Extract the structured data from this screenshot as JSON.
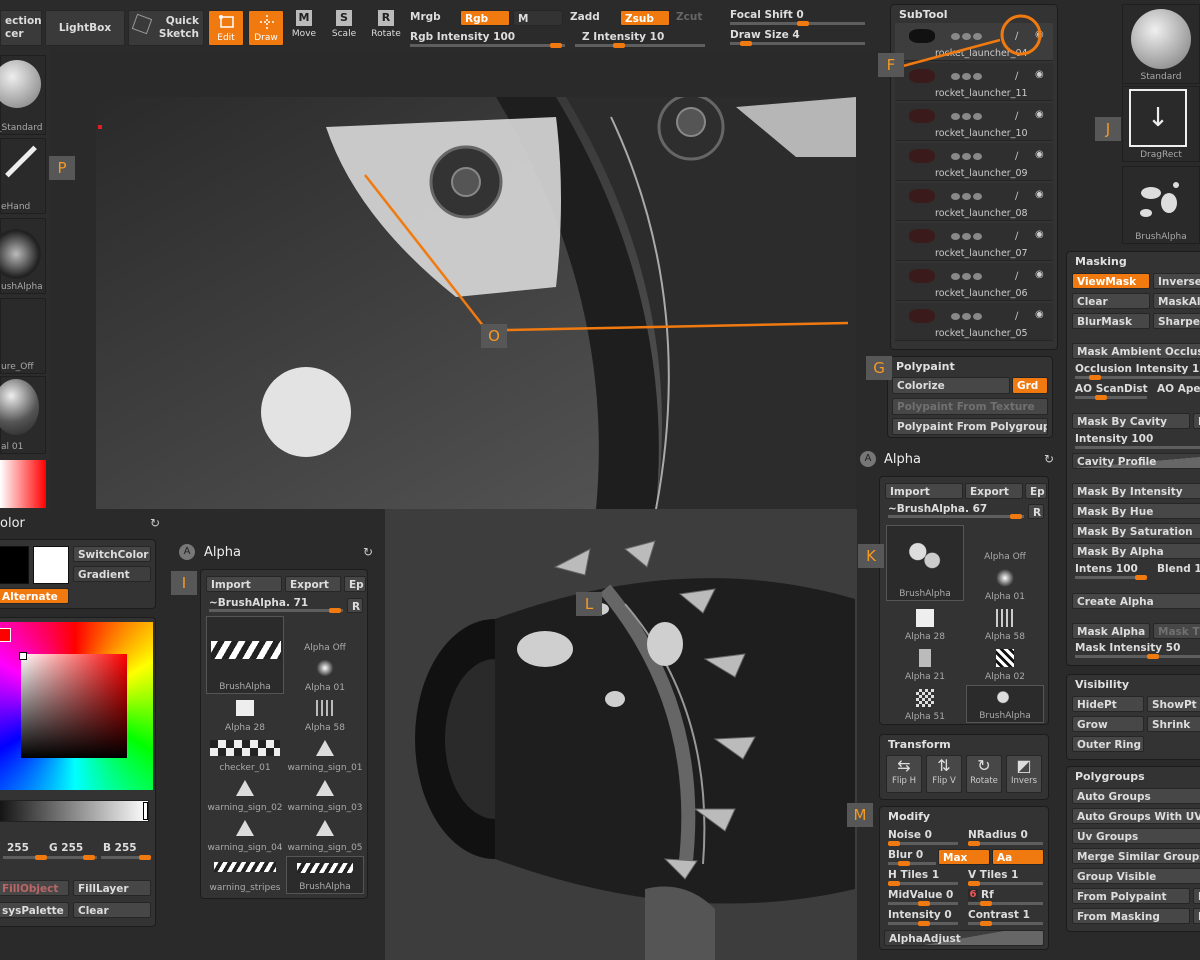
{
  "toolbar": {
    "selection": "ection",
    "selection2": "cer",
    "lightbox": "LightBox",
    "quick": "Quick",
    "sketch": "Sketch",
    "edit": "Edit",
    "draw": "Draw",
    "move": "Move",
    "scale": "Scale",
    "rotate": "Rotate",
    "mrgb": "Mrgb",
    "rgb": "Rgb",
    "m": "M",
    "zadd": "Zadd",
    "zsub": "Zsub",
    "zcut": "Zcut",
    "rgb_intensity": "Rgb Intensity 100",
    "z_intensity": "Z Intensity 10",
    "focal_shift": "Focal Shift 0",
    "draw_size": "Draw Size 4"
  },
  "left_tray": {
    "items": [
      "_Standard",
      "eHand",
      "ushAlpha",
      "ure_Off",
      "al 01"
    ]
  },
  "subtool": {
    "title": "SubTool",
    "items": [
      "rocket_launcher_04",
      "rocket_launcher_11",
      "rocket_launcher_10",
      "rocket_launcher_09",
      "rocket_launcher_08",
      "rocket_launcher_07",
      "rocket_launcher_06",
      "rocket_launcher_05"
    ]
  },
  "polypaint": {
    "title": "Polypaint",
    "colorize": "Colorize",
    "grd": "Grd",
    "from_texture": "Polypaint From Texture",
    "from_polygroup": "Polypaint From Polygroup"
  },
  "alpha_right": {
    "title": "Alpha",
    "import": "Import",
    "export": "Export",
    "ep": "Ep",
    "brush": "~BrushAlpha. 67",
    "r": "R",
    "thumbs": [
      "BrushAlpha",
      "Alpha Off",
      "Alpha 01",
      "Alpha 28",
      "Alpha 58",
      "Alpha 21",
      "Alpha 02",
      "Alpha 51",
      "BrushAlpha"
    ]
  },
  "transform": {
    "title": "Transform",
    "buttons": [
      "Flip H",
      "Flip V",
      "Rotate",
      "Invers"
    ]
  },
  "modify": {
    "title": "Modify",
    "noise": "Noise 0",
    "nradius": "NRadius 0",
    "blur": "Blur 0",
    "max": "Max",
    "aa": "Aa",
    "htiles": "H Tiles 1",
    "vtiles": "V Tiles 1",
    "midvalue": "MidValue 0",
    "rf": "Rf",
    "rf_val": "6",
    "intensity": "Intensity 0",
    "contrast": "Contrast 1",
    "alphaadjust": "AlphaAdjust"
  },
  "right_tray": {
    "standard": "Standard",
    "dragrect": "DragRect",
    "brushalpha": "BrushAlpha"
  },
  "masking": {
    "title": "Masking",
    "viewmask": "ViewMask",
    "inverse": "Inverse",
    "clear": "Clear",
    "maskall": "MaskAll",
    "blurmask": "BlurMask",
    "sharpen": "Sharpen",
    "ambient": "Mask Ambient Occlus",
    "occ_int": "Occlusion Intensity 1",
    "ao_scan": "AO ScanDist",
    "ao_ape": "AO Ape",
    "by_cavity": "Mask By Cavity",
    "b": "B",
    "cav_int": "Intensity 100",
    "cav_profile": "Cavity Profile",
    "by_intensity": "Mask By Intensity",
    "by_hue": "Mask By Hue",
    "by_sat": "Mask By Saturation",
    "by_alpha": "Mask By Alpha",
    "intens": "Intens 100",
    "blend": "Blend 1",
    "create_alpha": "Create Alpha",
    "mask_alpha": "Mask Alpha",
    "mask_t": "Mask T",
    "mask_int": "Mask Intensity 50"
  },
  "visibility": {
    "title": "Visibility",
    "hidept": "HidePt",
    "showpt": "ShowPt",
    "grow": "Grow",
    "shrink": "Shrink",
    "outer": "Outer Ring"
  },
  "polygroups": {
    "title": "Polygroups",
    "items": [
      "Auto Groups",
      "Auto Groups With UV",
      "Uv Groups",
      "Merge Similar Groups",
      "Group Visible",
      "From Polypaint",
      "From Masking"
    ],
    "side": [
      "P",
      "M"
    ]
  },
  "color": {
    "title": "olor",
    "switch": "SwitchColor",
    "gradient": "Gradient",
    "alternate": "Alternate",
    "r": "255",
    "g": "G 255",
    "b": "B 255",
    "fillobject": "FillObject",
    "filllayer": "FillLayer",
    "syspalette": "sysPalette",
    "clear": "Clear"
  },
  "alpha_left": {
    "title": "Alpha",
    "import": "Import",
    "export": "Export",
    "ep": "Ep",
    "brush": "~BrushAlpha. 71",
    "r": "R",
    "thumbs": [
      "BrushAlpha",
      "Alpha Off",
      "Alpha 01",
      "Alpha 28",
      "Alpha 58",
      "checker_01",
      "warning_sign_01",
      "warning_sign_02",
      "warning_sign_03",
      "warning_sign_04",
      "warning_sign_05",
      "warning_stripes",
      "BrushAlpha"
    ]
  },
  "tags": {
    "F": "F",
    "P": "P",
    "O": "O",
    "G": "G",
    "K": "K",
    "I": "I",
    "L": "L",
    "M": "M",
    "J": "J"
  },
  "colors": {
    "accent": "#f07a10",
    "panel": "#333333",
    "bg": "#2a2a2a"
  }
}
